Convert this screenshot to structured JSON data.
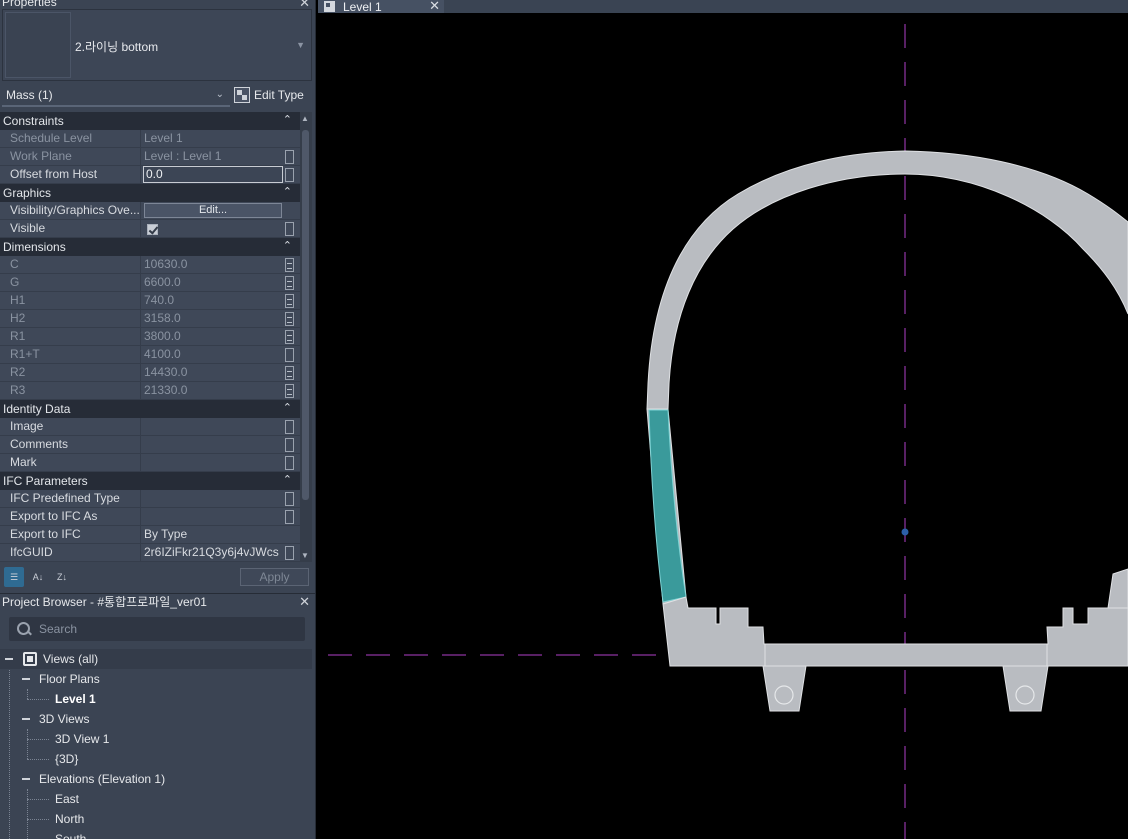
{
  "properties": {
    "title": "Properties",
    "close": "✕",
    "type_name": "2.라이닝 bottom",
    "instance_filter": "Mass (1)",
    "edit_type": "Edit Type",
    "apply": "Apply",
    "groups": {
      "constraints": "Constraints",
      "graphics": "Graphics",
      "dimensions": "Dimensions",
      "identity": "Identity Data",
      "ifc": "IFC Parameters"
    },
    "rows": {
      "schedule_level": {
        "name": "Schedule Level",
        "value": "Level 1"
      },
      "work_plane": {
        "name": "Work Plane",
        "value": "Level : Level 1"
      },
      "offset": {
        "name": "Offset from Host",
        "value": "0.0"
      },
      "vis_graphics": {
        "name": "Visibility/Graphics Ove...",
        "value": "Edit..."
      },
      "visible": {
        "name": "Visible",
        "value": ""
      },
      "C": {
        "name": "C",
        "value": "10630.0"
      },
      "G": {
        "name": "G",
        "value": "6600.0"
      },
      "H1": {
        "name": "H1",
        "value": "740.0"
      },
      "H2": {
        "name": "H2",
        "value": "3158.0"
      },
      "R1": {
        "name": "R1",
        "value": "3800.0"
      },
      "R1T": {
        "name": "R1+T",
        "value": "4100.0"
      },
      "R2": {
        "name": "R2",
        "value": "14430.0"
      },
      "R3": {
        "name": "R3",
        "value": "21330.0"
      },
      "image": {
        "name": "Image",
        "value": ""
      },
      "comments": {
        "name": "Comments",
        "value": ""
      },
      "mark": {
        "name": "Mark",
        "value": ""
      },
      "ifc_predef": {
        "name": "IFC Predefined Type",
        "value": ""
      },
      "export_ifc_as": {
        "name": "Export to IFC As",
        "value": ""
      },
      "export_ifc": {
        "name": "Export to IFC",
        "value": "By Type"
      },
      "ifc_guid": {
        "name": "IfcGUID",
        "value": "2r6IZiFkr21Q3y6j4vJWcs"
      }
    }
  },
  "browser": {
    "title": "Project Browser - #통합프로파일_ver01",
    "close": "✕",
    "search_placeholder": "Search",
    "tree": {
      "views_all": "Views (all)",
      "floor_plans": "Floor Plans",
      "level1": "Level 1",
      "views_3d": "3D Views",
      "view_3d_1": "3D View 1",
      "view_3d": "{3D}",
      "elevations": "Elevations (Elevation 1)",
      "east": "East",
      "north": "North",
      "south": "South"
    }
  },
  "view": {
    "tab_label": "Level 1",
    "tab_close": "✕"
  },
  "colors": {
    "selected_fill": "#3a9a9b",
    "section_fill": "#b9bcc1",
    "reference_line": "#b040c8"
  }
}
